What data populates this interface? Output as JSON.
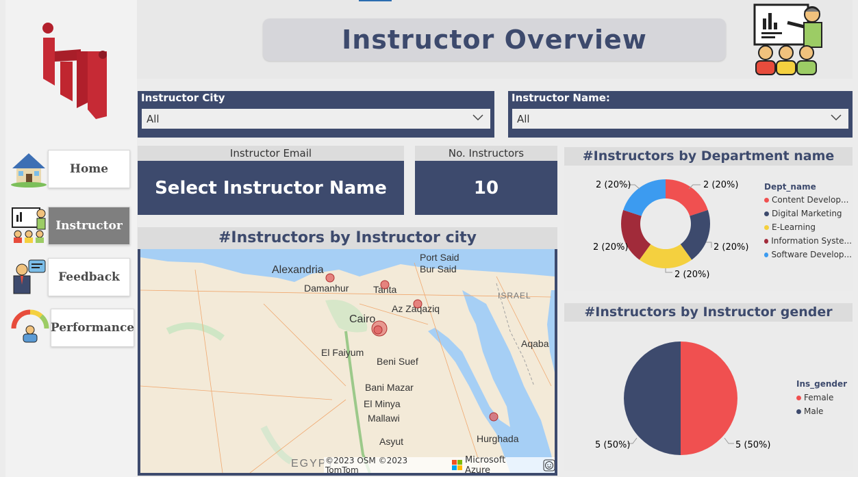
{
  "title": "Instructor Overview",
  "nav": [
    {
      "label": "Home",
      "icon": "house-icon"
    },
    {
      "label": "Instructor",
      "icon": "teacher-icon"
    },
    {
      "label": "Feedback",
      "icon": "feedback-icon"
    },
    {
      "label": "Performance",
      "icon": "gauge-icon"
    }
  ],
  "slicers": {
    "city": {
      "label": "Instructor City",
      "value": "All"
    },
    "name": {
      "label": "Instructor Name:",
      "value": "All"
    }
  },
  "cards": {
    "email": {
      "label": "Instructor Email",
      "value": "Select Instructor Name"
    },
    "count": {
      "label": "No. Instructors",
      "value": "10"
    }
  },
  "map": {
    "title": "#Instructors by Instructor city",
    "places": [
      "Alexandria",
      "Damanhur",
      "Tanta",
      "Port Said",
      "Bur Said",
      "Az Zaqaziq",
      "Cairo",
      "El Faiyum",
      "Beni Suef",
      "Bani Mazar",
      "El Minya",
      "Mallawi",
      "Asyut",
      "Hurghada",
      "Aqaba",
      "ISRAEL",
      "EGYPT"
    ],
    "attribution": "©2023 OSM ©2023 TomTom",
    "provider": "Microsoft Azure"
  },
  "colors": {
    "navy": "#3d4a6d",
    "red": "#f05050",
    "yellow": "#f4d03f",
    "maroon": "#a12b3a",
    "blue": "#3c9bf0"
  },
  "chart_data": [
    {
      "type": "pie",
      "title": "#Instructors by Department name",
      "legend_title": "Dept_name",
      "categories": [
        "Content Develop...",
        "Digital Marketing",
        "E-Learning",
        "Information Syste...",
        "Software Develop..."
      ],
      "values": [
        2,
        2,
        2,
        2,
        2
      ],
      "labels": [
        "2 (20%)",
        "2 (20%)",
        "2 (20%)",
        "2 (20%)",
        "2 (20%)"
      ],
      "colors": [
        "#f05050",
        "#3d4a6d",
        "#f4d03f",
        "#a12b3a",
        "#3c9bf0"
      ],
      "donut": true,
      "legend": "right"
    },
    {
      "type": "pie",
      "title": "#Instructors by Instructor gender",
      "legend_title": "Ins_gender",
      "categories": [
        "Female",
        "Male"
      ],
      "values": [
        5,
        5
      ],
      "labels": [
        "5 (50%)",
        "5 (50%)"
      ],
      "colors": [
        "#f05050",
        "#3d4a6d"
      ],
      "legend": "right"
    }
  ]
}
